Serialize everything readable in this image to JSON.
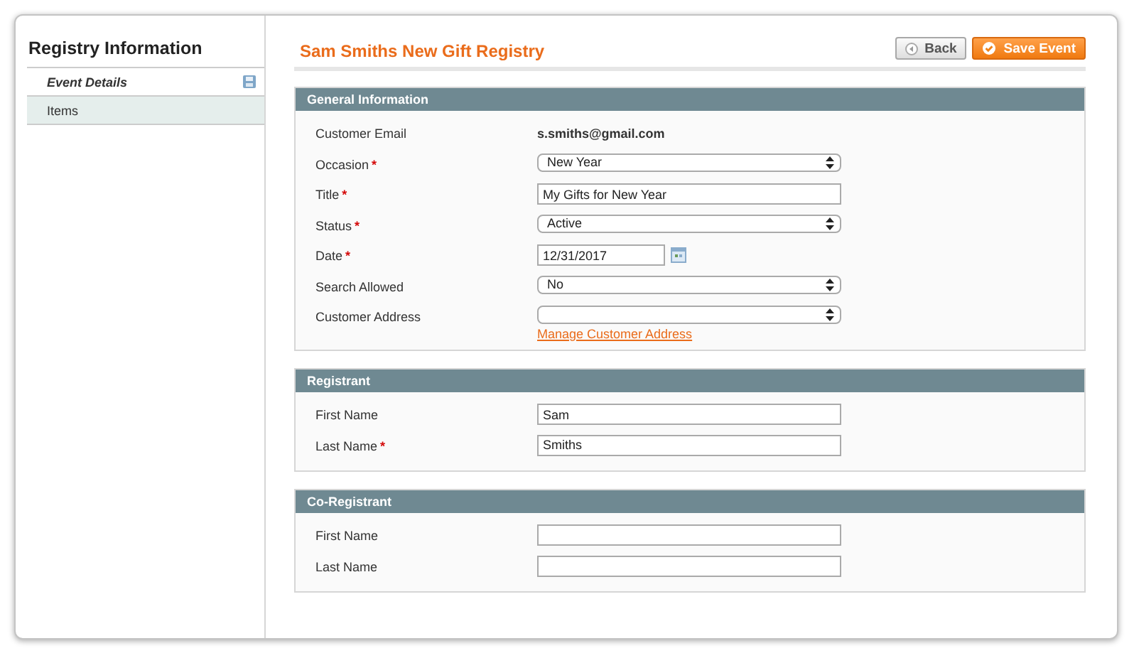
{
  "sidebar": {
    "title": "Registry Information",
    "tabs": [
      {
        "label": "Event Details",
        "selected": true,
        "changed": true
      },
      {
        "label": "Items",
        "selected": false,
        "changed": false
      }
    ]
  },
  "header": {
    "title": "Sam Smiths New Gift Registry",
    "buttons": [
      {
        "label": "Back",
        "kind": "back"
      },
      {
        "label": "Save Event",
        "kind": "save"
      }
    ]
  },
  "sections": [
    {
      "title": "General Information",
      "fields": [
        {
          "label": "Customer Email",
          "kind": "static",
          "value": "s.smiths@gmail.com"
        },
        {
          "label": "Occasion",
          "required_mark": "*",
          "kind": "select",
          "value": "New Year"
        },
        {
          "label": "Title",
          "required_mark": "*",
          "kind": "text",
          "value": "My Gifts for New Year"
        },
        {
          "label": "Status",
          "required_mark": "*",
          "kind": "select",
          "value": "Active"
        },
        {
          "label": "Date",
          "required_mark": "*",
          "kind": "date",
          "value": "12/31/2017"
        },
        {
          "label": "Search Allowed",
          "kind": "select",
          "value": "No"
        },
        {
          "label": "Customer Address",
          "kind": "select",
          "link": "Manage Customer Address"
        }
      ]
    },
    {
      "title": "Registrant",
      "fields": [
        {
          "label": "First Name",
          "kind": "text",
          "value": "Sam"
        },
        {
          "label": "Last Name",
          "required_mark": "*",
          "kind": "text",
          "value": "Smiths"
        }
      ]
    },
    {
      "title": "Co-Registrant",
      "fields": [
        {
          "label": "First Name",
          "kind": "text"
        },
        {
          "label": "Last Name",
          "kind": "text"
        }
      ]
    }
  ]
}
